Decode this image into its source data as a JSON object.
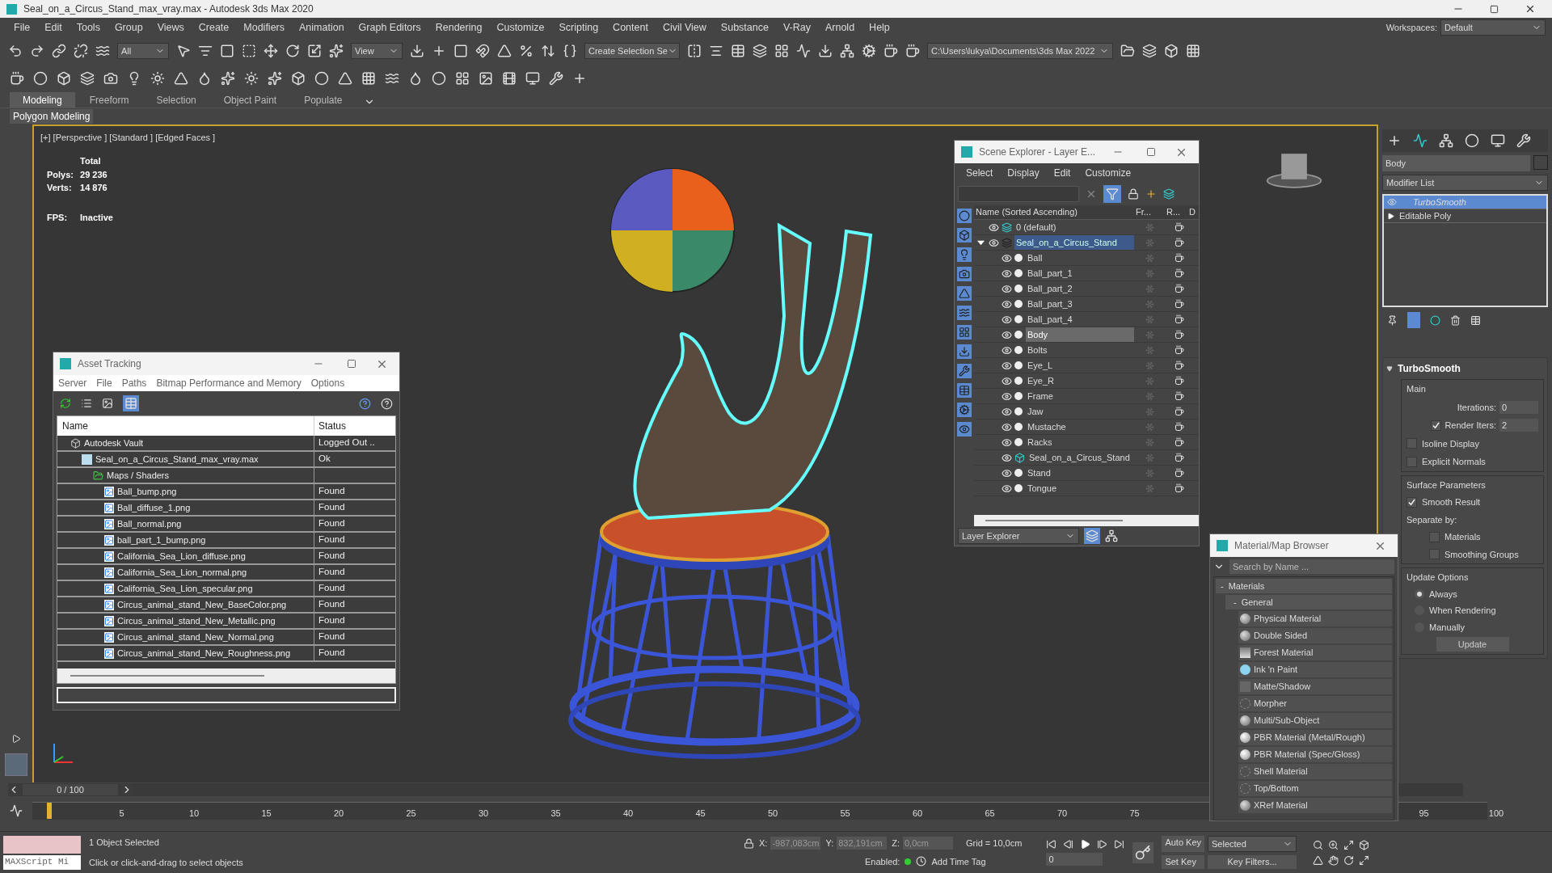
{
  "window": {
    "title": "Seal_on_a_Circus_Stand_max_vray.max - Autodesk 3ds Max 2020"
  },
  "menu": [
    "File",
    "Edit",
    "Tools",
    "Group",
    "Views",
    "Create",
    "Modifiers",
    "Animation",
    "Graph Editors",
    "Rendering",
    "Customize",
    "Scripting",
    "Content",
    "Civil View",
    "Substance",
    "V-Ray",
    "Arnold",
    "Help"
  ],
  "workspaces": {
    "label": "Workspaces:",
    "value": "Default"
  },
  "toolbar": {
    "selection_filter": "All",
    "reference_coord": "View",
    "named_selection": "Create Selection Se",
    "project_path": "C:\\Users\\lukya\\Documents\\3ds Max 2022"
  },
  "ribbon": {
    "tabs": [
      {
        "label": "Modeling",
        "selected": true
      },
      {
        "label": "Freeform",
        "selected": false
      },
      {
        "label": "Selection",
        "selected": false
      },
      {
        "label": "Object Paint",
        "selected": false
      },
      {
        "label": "Populate",
        "selected": false
      }
    ],
    "panel": "Polygon Modeling"
  },
  "viewport": {
    "label": "[+] [Perspective ] [Standard ] [Edged Faces ]",
    "stats": {
      "heading": "Total",
      "rows": [
        {
          "label": "Polys:",
          "value": "29 236"
        },
        {
          "label": "Verts:",
          "value": "14 876"
        }
      ],
      "fps_label": "FPS:",
      "fps_value": "Inactive"
    }
  },
  "asset_tracking": {
    "title": "Asset Tracking",
    "menu": [
      "Server",
      "File",
      "Paths",
      "Bitmap Performance and Memory",
      "Options"
    ],
    "columns": [
      "Name",
      "Status"
    ],
    "tree": [
      {
        "name": "Autodesk Vault",
        "status": "Logged Out ..",
        "kind": "vault",
        "children": [
          {
            "name": "Seal_on_a_Circus_Stand_max_vray.max",
            "status": "Ok",
            "kind": "scene",
            "children": [
              {
                "name": "Maps / Shaders",
                "kind": "folder",
                "children": [
                  {
                    "name": "Ball_bump.png",
                    "status": "Found",
                    "kind": "bitmap"
                  },
                  {
                    "name": "Ball_diffuse_1.png",
                    "status": "Found",
                    "kind": "bitmap"
                  },
                  {
                    "name": "Ball_normal.png",
                    "status": "Found",
                    "kind": "bitmap"
                  },
                  {
                    "name": "ball_part_1_bump.png",
                    "status": "Found",
                    "kind": "bitmap"
                  },
                  {
                    "name": "California_Sea_Lion_diffuse.png",
                    "status": "Found",
                    "kind": "bitmap"
                  },
                  {
                    "name": "California_Sea_Lion_normal.png",
                    "status": "Found",
                    "kind": "bitmap"
                  },
                  {
                    "name": "California_Sea_Lion_specular.png",
                    "status": "Found",
                    "kind": "bitmap"
                  },
                  {
                    "name": "Circus_animal_stand_New_BaseColor.png",
                    "status": "Found",
                    "kind": "bitmap"
                  },
                  {
                    "name": "Circus_animal_stand_New_Metallic.png",
                    "status": "Found",
                    "kind": "bitmap"
                  },
                  {
                    "name": "Circus_animal_stand_New_Normal.png",
                    "status": "Found",
                    "kind": "bitmap"
                  },
                  {
                    "name": "Circus_animal_stand_New_Roughness.png",
                    "status": "Found",
                    "kind": "bitmap"
                  }
                ]
              }
            ]
          }
        ]
      }
    ]
  },
  "scene_explorer": {
    "title": "Scene Explorer - Layer E...",
    "menu": [
      "Select",
      "Display",
      "Edit",
      "Customize"
    ],
    "columns": [
      "Name (Sorted Ascending)",
      "Fr...",
      "R...",
      "D"
    ],
    "footer": "Layer Explorer",
    "tree": [
      {
        "name": "0 (default)",
        "kind": "layer",
        "selected": false
      },
      {
        "name": "Seal_on_a_Circus_Stand",
        "kind": "layer",
        "selected": true,
        "expanded": true,
        "children": [
          {
            "name": "Ball",
            "kind": "object",
            "selected": false
          },
          {
            "name": "Ball_part_1",
            "kind": "object",
            "selected": false
          },
          {
            "name": "Ball_part_2",
            "kind": "object",
            "selected": false
          },
          {
            "name": "Ball_part_3",
            "kind": "object",
            "selected": false
          },
          {
            "name": "Ball_part_4",
            "kind": "object",
            "selected": false
          },
          {
            "name": "Body",
            "kind": "object",
            "selected": true
          },
          {
            "name": "Bolts",
            "kind": "object",
            "selected": false
          },
          {
            "name": "Eye_L",
            "kind": "object",
            "selected": false
          },
          {
            "name": "Eye_R",
            "kind": "object",
            "selected": false
          },
          {
            "name": "Frame",
            "kind": "object",
            "selected": false
          },
          {
            "name": "Jaw",
            "kind": "object",
            "selected": false
          },
          {
            "name": "Mustache",
            "kind": "object",
            "selected": false
          },
          {
            "name": "Racks",
            "kind": "object",
            "selected": false
          },
          {
            "name": "Seal_on_a_Circus_Stand",
            "kind": "group",
            "selected": false
          },
          {
            "name": "Stand",
            "kind": "object",
            "selected": false
          },
          {
            "name": "Tongue",
            "kind": "object",
            "selected": false
          }
        ]
      }
    ]
  },
  "command_panel": {
    "object_name": "Body",
    "modifier_list": "Modifier List",
    "stack": [
      {
        "name": "TurboSmooth",
        "selected": true,
        "kind": "modifier"
      },
      {
        "name": "Editable Poly",
        "selected": false,
        "kind": "base"
      }
    ],
    "rollout": {
      "title": "TurboSmooth",
      "main": {
        "title": "Main",
        "iterations": {
          "label": "Iterations:",
          "value": "0"
        },
        "render_iters": {
          "label": "Render Iters:",
          "value": "2",
          "checked": true
        },
        "checks": [
          {
            "label": "Isoline Display",
            "checked": false
          },
          {
            "label": "Explicit Normals",
            "checked": false
          }
        ]
      },
      "surface": {
        "title": "Surface Parameters",
        "smooth_result": {
          "label": "Smooth Result",
          "checked": true
        },
        "separate_label": "Separate by:",
        "separate": [
          {
            "label": "Materials",
            "checked": false
          },
          {
            "label": "Smoothing Groups",
            "checked": false
          }
        ]
      },
      "update": {
        "title": "Update Options",
        "options": [
          {
            "label": "Always",
            "selected": true
          },
          {
            "label": "When Rendering",
            "selected": false
          },
          {
            "label": "Manually",
            "selected": false
          }
        ],
        "button": "Update"
      }
    }
  },
  "material_browser": {
    "title": "Material/Map Browser",
    "search_placeholder": "Search by Name ...",
    "collapse_glyph": "-",
    "group": "Materials",
    "subgroup": "General",
    "items": [
      {
        "name": "Physical Material",
        "kind": "sphere"
      },
      {
        "name": "Double Sided",
        "kind": "sphere"
      },
      {
        "name": "Forest Material",
        "kind": "gradient"
      },
      {
        "name": "Ink 'n Paint",
        "kind": "toon"
      },
      {
        "name": "Matte/Shadow",
        "kind": "flat"
      },
      {
        "name": "Morpher",
        "kind": "empty"
      },
      {
        "name": "Multi/Sub-Object",
        "kind": "sphere"
      },
      {
        "name": "PBR Material (Metal/Rough)",
        "kind": "shiny"
      },
      {
        "name": "PBR Material (Spec/Gloss)",
        "kind": "shiny"
      },
      {
        "name": "Shell Material",
        "kind": "empty"
      },
      {
        "name": "Top/Bottom",
        "kind": "empty"
      },
      {
        "name": "XRef Material",
        "kind": "sphere"
      }
    ]
  },
  "timeline": {
    "slider": "0 / 100",
    "ticks": [
      "5",
      "10",
      "15",
      "20",
      "25",
      "30",
      "35",
      "40",
      "45",
      "50",
      "55",
      "60",
      "65",
      "70",
      "75",
      "95",
      "100"
    ]
  },
  "status_bar": {
    "maxscript": "MAXScript Mi",
    "selection": "1 Object Selected",
    "prompt": "Click or click-and-drag to select objects",
    "coords": [
      {
        "label": "X:",
        "value": "-987,083cm"
      },
      {
        "label": "Y:",
        "value": "832,191cm"
      },
      {
        "label": "Z:",
        "value": "0,0cm"
      }
    ],
    "grid": "Grid = 10,0cm",
    "enabled": "Enabled:",
    "add_time_tag": "Add Time Tag",
    "auto_key": "Auto Key",
    "key_mode": "Selected",
    "set_key": "Set Key",
    "key_filters": "Key Filters...",
    "frame": "0"
  }
}
